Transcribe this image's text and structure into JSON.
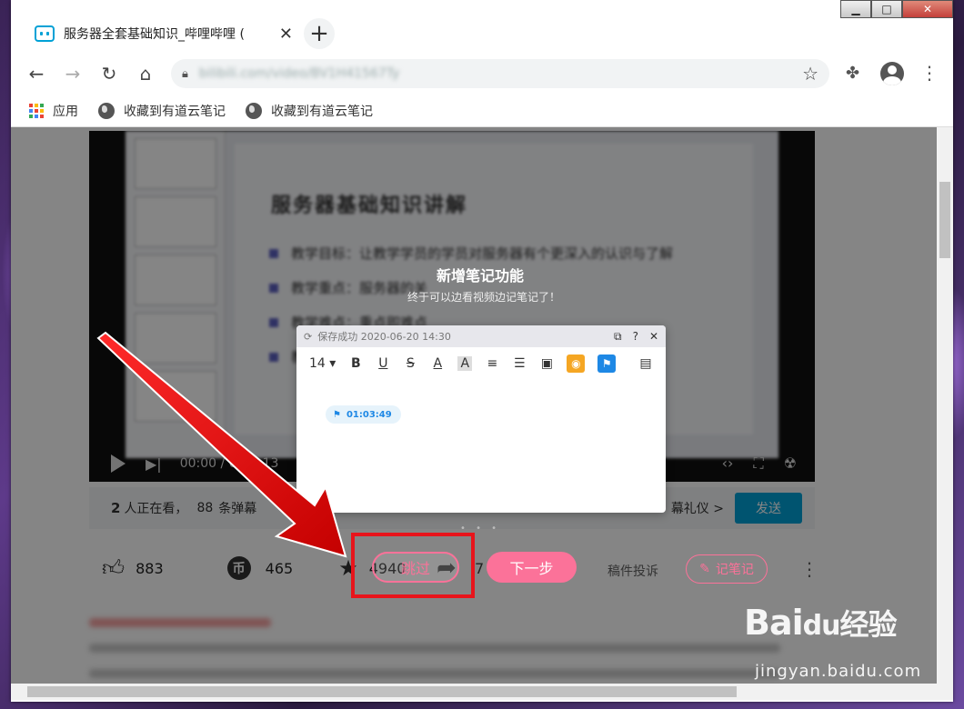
{
  "browser": {
    "tab_title": "服务器全套基础知识_哔哩哔哩 (",
    "tab_close": "✕",
    "new_tab": "+",
    "url": "bilibili.com/video/BV1H41567Ty",
    "window_controls": {
      "minimize": "▁",
      "maximize": "□",
      "close": "✕"
    }
  },
  "bookmarks": {
    "apps_label": "应用",
    "items": [
      "收藏到有道云笔记",
      "收藏到有道云笔记"
    ],
    "apps_colors": [
      "#ea4335",
      "#fbbc05",
      "#34a853",
      "#4285f4",
      "#ea4335",
      "#fbbc05",
      "#34a853",
      "#4285f4",
      "#ea4335"
    ]
  },
  "slide": {
    "heading": "服务器基础知识讲解",
    "lines": [
      "教学目标：让教学学员的学员对服务器有个更深入的认识与了解",
      "教学重点：服务器的关",
      "教学难点：重点即难点",
      "教"
    ]
  },
  "player": {
    "time": "00:00 / 0",
    "time_tail": "13"
  },
  "feature": {
    "title": "新增笔记功能",
    "subtitle": "终于可以边看视频边记笔记了！"
  },
  "note_panel": {
    "status": "保存成功 2020-06-20  14:30",
    "font_size": "14",
    "timestamp": "01:03:49",
    "tools": [
      "B",
      "U",
      "S",
      "A",
      "A"
    ]
  },
  "stats": {
    "watching_count": "2",
    "watching_label": "人正在看，",
    "danmaku_count": "88",
    "danmaku_label": "条弹幕",
    "gift_text": "幕礼仪 >",
    "send_label": "发送"
  },
  "actions": {
    "likes": "883",
    "coins": "465",
    "favorites": "4940",
    "shares": "7",
    "skip_label": "跳过",
    "next_label": "下一步",
    "report_label": "稿件投诉",
    "notes_label": "记笔记"
  },
  "watermark": {
    "brand": "Bai",
    "brand_du": "du",
    "brand_cn": "经验",
    "sub": "jingyan.baidu.com"
  }
}
